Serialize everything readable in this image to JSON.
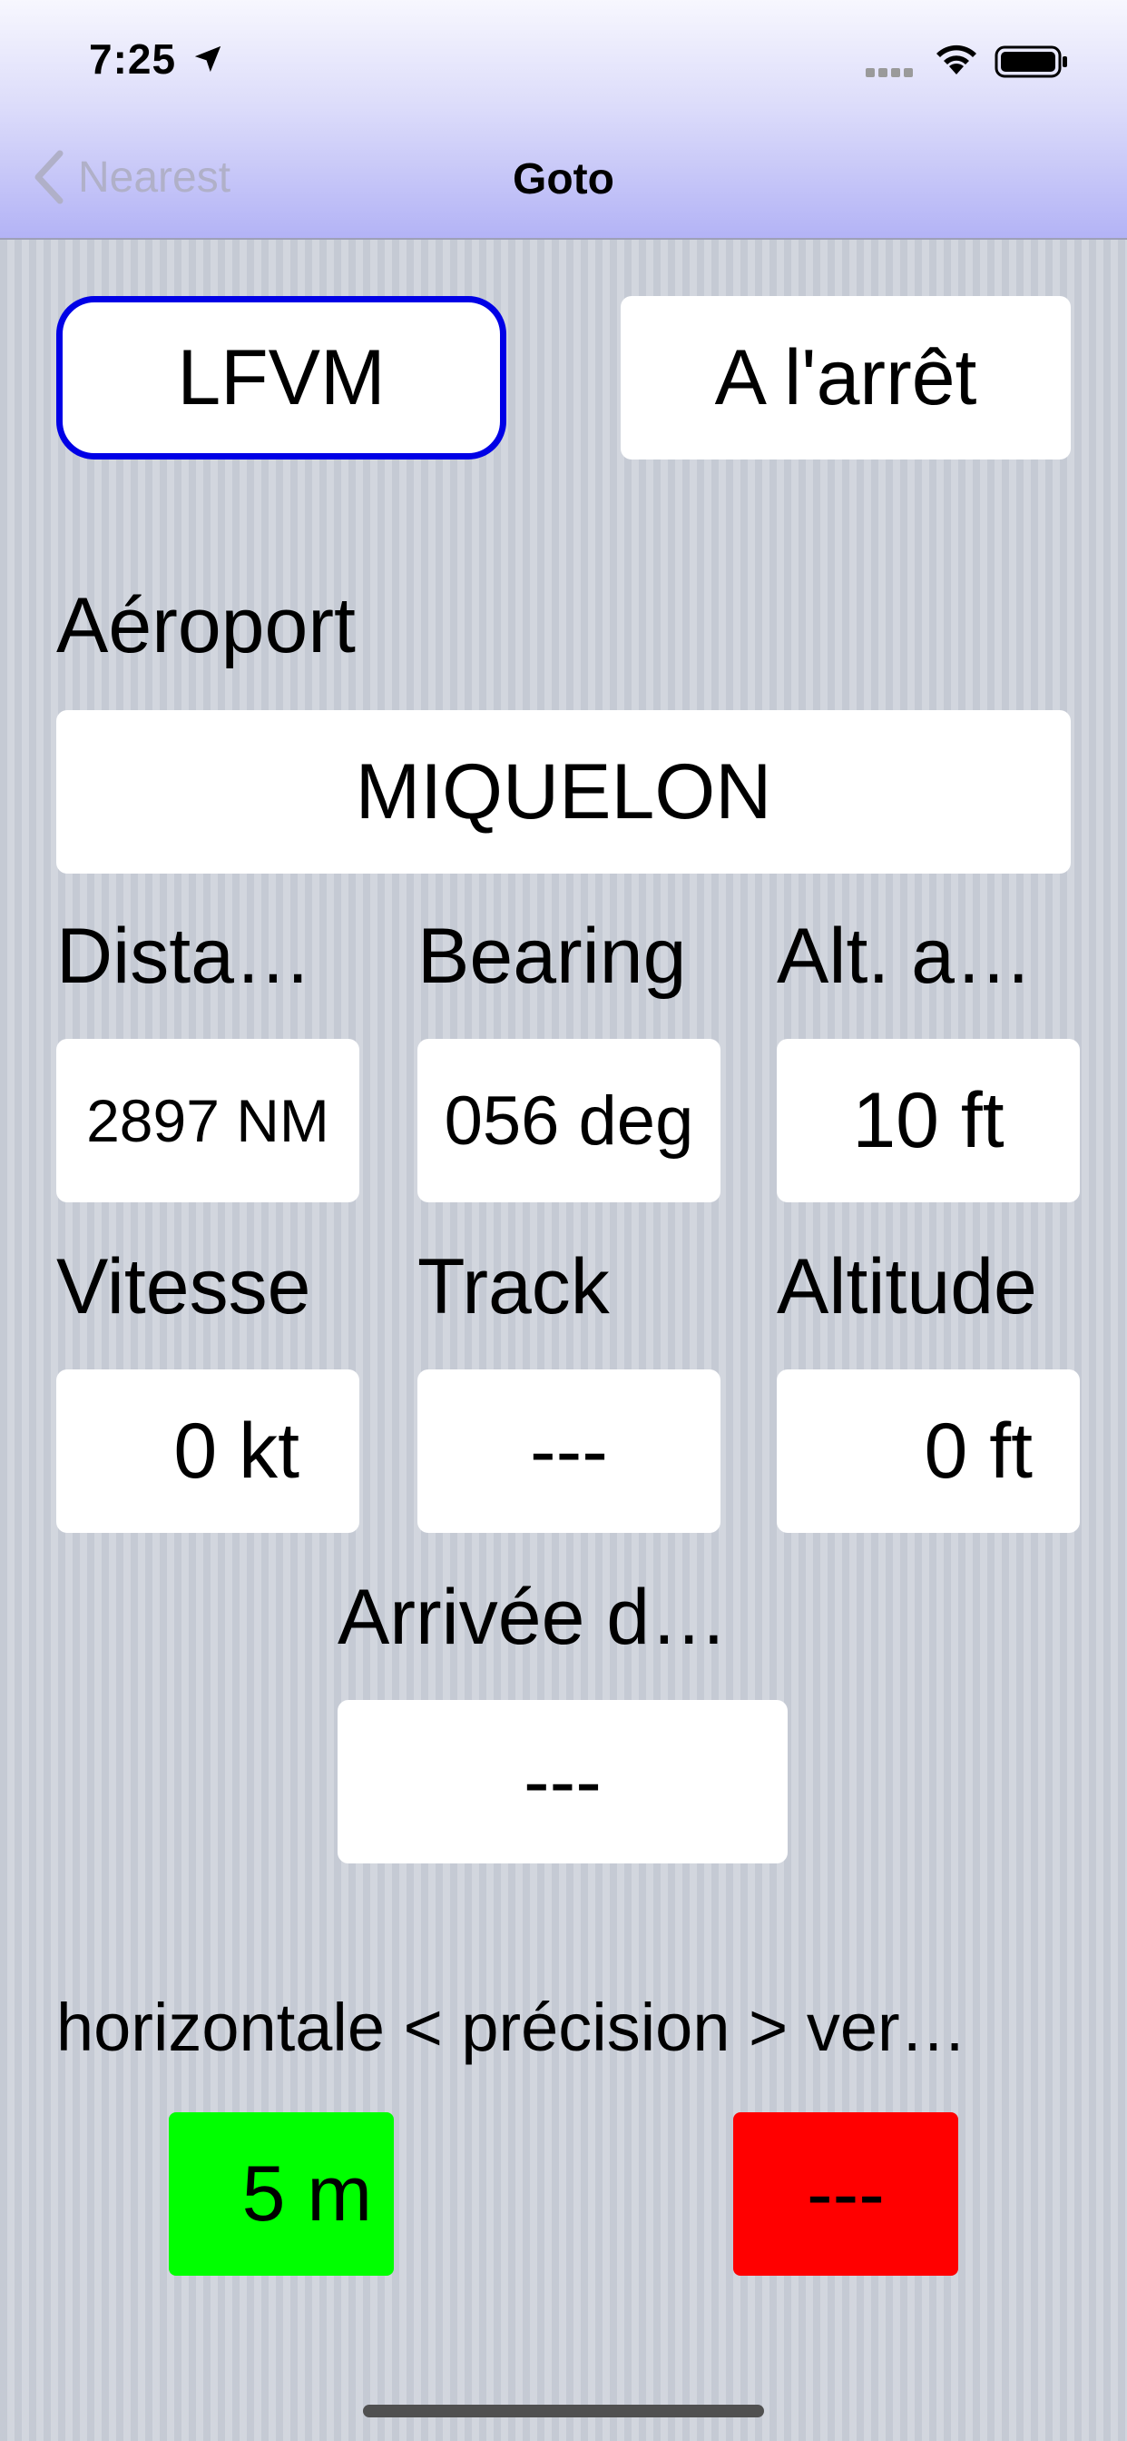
{
  "status_bar": {
    "time": "7:25"
  },
  "nav": {
    "back_label": "Nearest",
    "title": "Goto"
  },
  "top": {
    "airport_code": "LFVM",
    "motion_status": "A l'arrêt"
  },
  "airport": {
    "label": "Aéroport",
    "name": "MIQUELON"
  },
  "row1": {
    "distance_label": "Dista…",
    "distance_value": "2897 NM",
    "bearing_label": "Bearing",
    "bearing_value": "056 deg",
    "alt_label": "Alt. a…",
    "alt_value": "10 ft"
  },
  "row2": {
    "speed_label": "Vitesse",
    "speed_value": "0 kt",
    "track_label": "Track",
    "track_value": "---",
    "altitude_label": "Altitude",
    "altitude_value": "0 ft"
  },
  "arrival": {
    "label": "Arrivée d…",
    "value": "---"
  },
  "precision": {
    "label": "horizontale < précision > ver…",
    "horizontal_value": "5 m",
    "horizontal_color": "#00ff00",
    "vertical_value": "---",
    "vertical_color": "#ff0000"
  }
}
